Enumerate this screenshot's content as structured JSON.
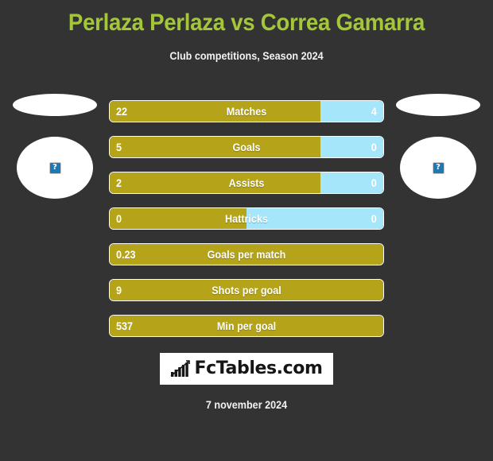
{
  "header": {
    "title": "Perlaza Perlaza vs Correa Gamarra",
    "subtitle": "Club competitions, Season 2024",
    "title_color": "#A4C639"
  },
  "players": {
    "home": {
      "flag_icon": "flag-placeholder",
      "avatar_icon": "broken-image-icon",
      "avatar_glyph": "?"
    },
    "away": {
      "flag_icon": "flag-placeholder",
      "avatar_icon": "broken-image-icon",
      "avatar_glyph": "?"
    }
  },
  "colors": {
    "home_bar": "#B5A41A",
    "away_bar": "#A5E6FA",
    "background": "#333333"
  },
  "stats": [
    {
      "label": "Matches",
      "home": "22",
      "away": "4",
      "home_pct": 77,
      "has_away": true
    },
    {
      "label": "Goals",
      "home": "5",
      "away": "0",
      "home_pct": 77,
      "has_away": true
    },
    {
      "label": "Assists",
      "home": "2",
      "away": "0",
      "home_pct": 77,
      "has_away": true
    },
    {
      "label": "Hattricks",
      "home": "0",
      "away": "0",
      "home_pct": 50,
      "has_away": true
    },
    {
      "label": "Goals per match",
      "home": "0.23",
      "away": "",
      "home_pct": 100,
      "has_away": false
    },
    {
      "label": "Shots per goal",
      "home": "9",
      "away": "",
      "home_pct": 100,
      "has_away": false
    },
    {
      "label": "Min per goal",
      "home": "537",
      "away": "",
      "home_pct": 100,
      "has_away": false
    }
  ],
  "logo": {
    "text": "FcTables.com",
    "icon": "bar-chart-icon"
  },
  "footer": {
    "date": "7 november 2024"
  }
}
